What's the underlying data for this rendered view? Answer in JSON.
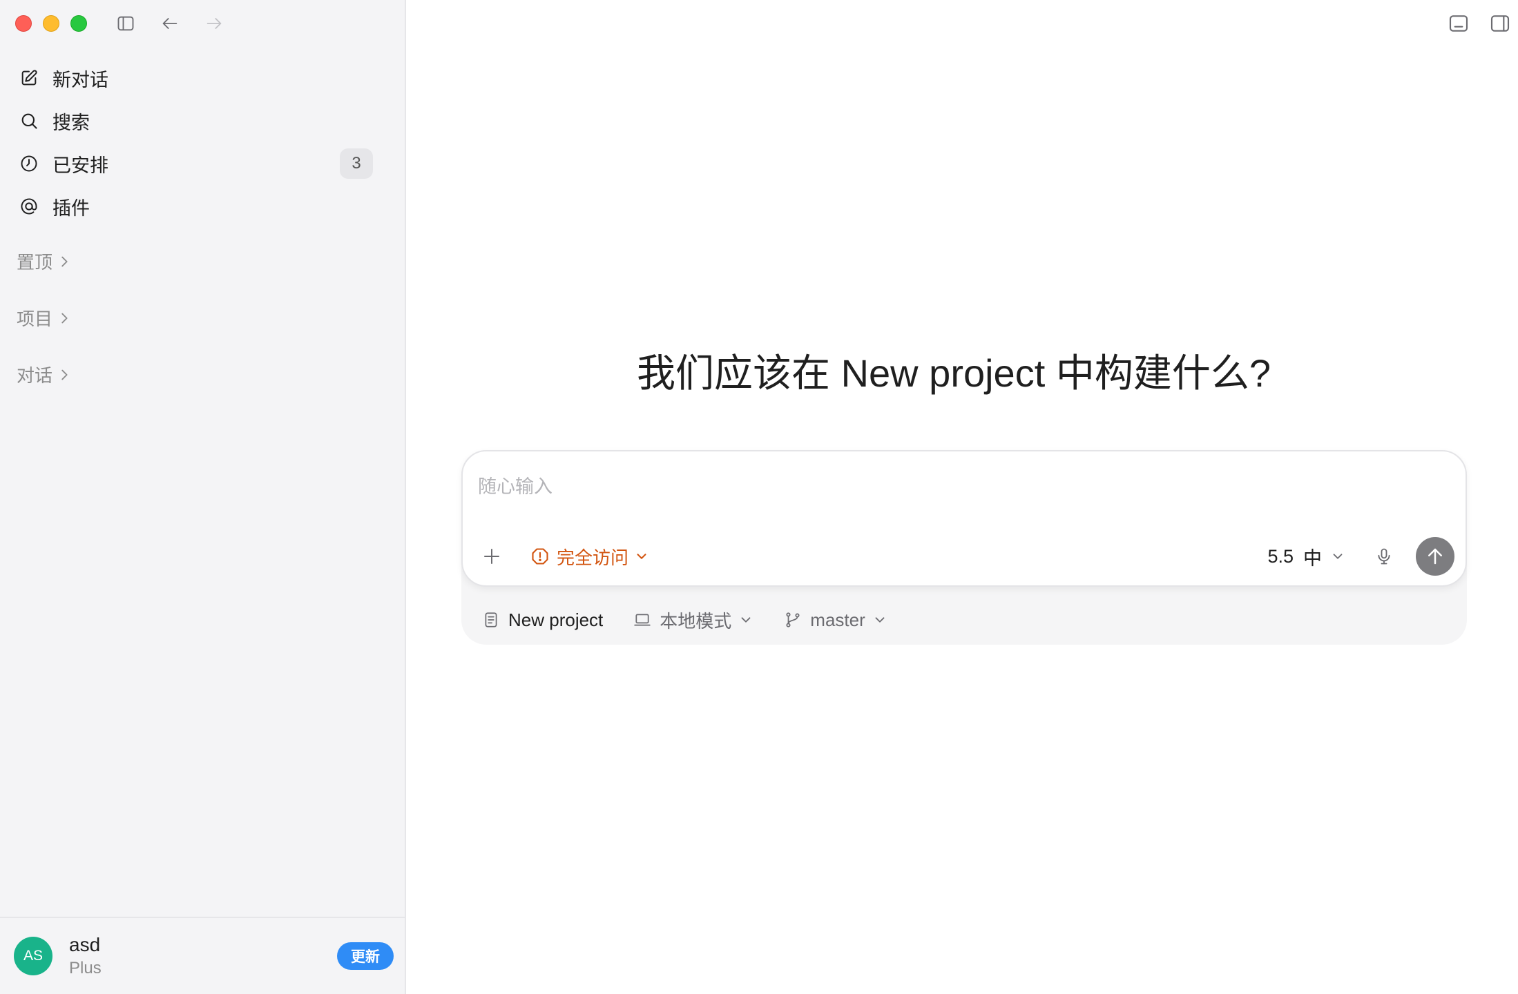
{
  "sidebar": {
    "nav": [
      {
        "label": "新对话",
        "icon": "edit-icon"
      },
      {
        "label": "搜索",
        "icon": "search-icon"
      },
      {
        "label": "已安排",
        "icon": "clock-icon",
        "badge": "3"
      },
      {
        "label": "插件",
        "icon": "at-sign-icon"
      }
    ],
    "sections": {
      "pinned": "置顶",
      "projects": "项目",
      "chats": "对话"
    },
    "account": {
      "initials": "AS",
      "name": "asd",
      "plan": "Plus",
      "upgrade_label": "更新"
    }
  },
  "main": {
    "headline": "我们应该在 New project 中构建什么?",
    "composer": {
      "placeholder": "随心输入",
      "access_label": "完全访问",
      "model_version": "5.5",
      "model_effort": "中"
    },
    "context": {
      "project": "New project",
      "mode": "本地模式",
      "branch": "master"
    }
  },
  "colors": {
    "accent_warning": "#d2540f",
    "upgrade_blue": "#2f8cf6",
    "avatar_green": "#19b38a",
    "send_button": "#7d7d80"
  }
}
